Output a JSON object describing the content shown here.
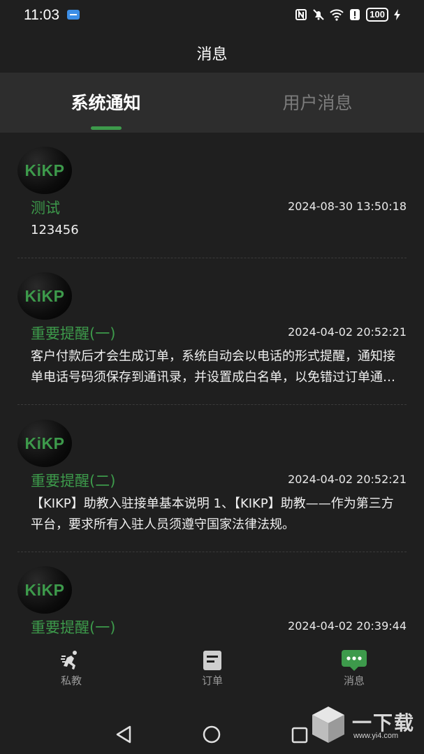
{
  "status_bar": {
    "time": "11:03",
    "battery": "100",
    "icons": [
      "usb-icon",
      "nfc-icon",
      "mute-icon",
      "wifi-icon",
      "alert-icon",
      "battery-icon",
      "charging-icon"
    ]
  },
  "header": {
    "title": "消息"
  },
  "tabs": [
    {
      "label": "系统通知",
      "active": true
    },
    {
      "label": "用户消息",
      "active": false
    }
  ],
  "messages": [
    {
      "avatar": "KiKP",
      "title": "测试",
      "time": "2024-08-30 13:50:18",
      "body": "123456"
    },
    {
      "avatar": "KiKP",
      "title": "重要提醒(一)",
      "time": "2024-04-02 20:52:21",
      "body": "客户付款后才会生成订单，系统自动会以电话的形式提醒，通知接单电话号码须保存到通讯录，并设置成白名单，以免错过订单通知。"
    },
    {
      "avatar": "KiKP",
      "title": "重要提醒(二)",
      "time": "2024-04-02 20:52:21",
      "body": "【KIKP】助教入驻接单基本说明 1、【KIKP】助教——作为第三方平台，要求所有入驻人员须遵守国家法律法规。"
    },
    {
      "avatar": "KiKP",
      "title": "重要提醒(一)",
      "time": "2024-04-02 20:39:44",
      "body": ""
    }
  ],
  "bottom_nav": [
    {
      "label": "私教",
      "icon": "runner-icon",
      "active": false
    },
    {
      "label": "订单",
      "icon": "order-icon",
      "active": false
    },
    {
      "label": "消息",
      "icon": "message-icon",
      "active": true
    }
  ],
  "colors": {
    "accent": "#3d9a4b",
    "background": "#1f1f1f",
    "tab_bar": "#2d2d2d"
  },
  "watermark": {
    "text": "一下载",
    "url": "www.yi4.com"
  }
}
